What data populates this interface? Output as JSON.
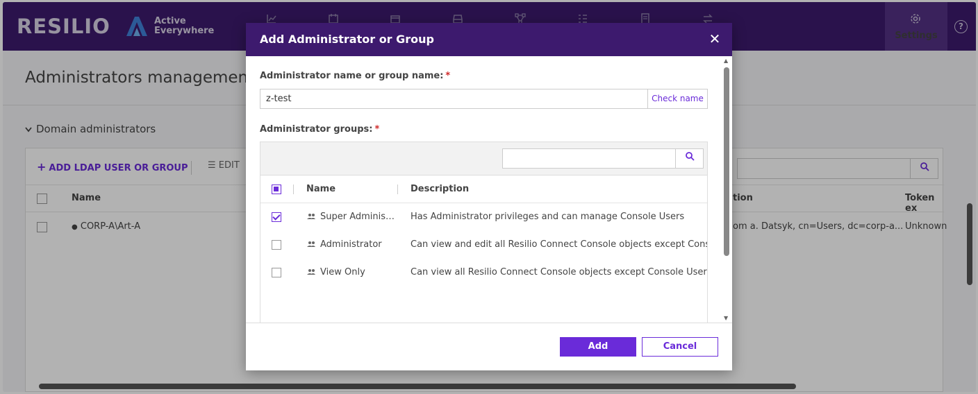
{
  "app": {
    "brand": "RESILIO",
    "product_line1": "Active",
    "product_line2": "Everywhere",
    "nav_settings_label": "Settings",
    "nav_icons": [
      "chart-icon",
      "calendar-icon",
      "package-icon",
      "storage-icon",
      "network-icon",
      "list-icon",
      "report-icon",
      "transfer-icon"
    ]
  },
  "page": {
    "title": "Administrators management",
    "section_title": "Domain administrators",
    "toolbar": {
      "add_label": "ADD LDAP USER OR GROUP",
      "edit_label": "EDIT"
    },
    "columns": {
      "name": "Name",
      "description_partial": "tion",
      "token_partial": "Token ex"
    },
    "rows": [
      {
        "name": "CORP-A\\Art-A",
        "description": "om a. Datsyk, cn=Users, dc=corp-a...",
        "token": "Unknown"
      }
    ]
  },
  "dialog": {
    "title": "Add Administrator or Group",
    "name_label": "Administrator name or group name:",
    "required_mark": "*",
    "name_value": "z-test",
    "check_name_label": "Check name",
    "groups_label": "Administrator groups:",
    "search_placeholder": "",
    "columns": {
      "name": "Name",
      "description": "Description"
    },
    "groups": [
      {
        "name": "Super Administrator",
        "description": "Has Administrator privileges and can manage Console Users",
        "checked": true
      },
      {
        "name": "Administrator",
        "description": "Can view and edit all Resilio Connect Console objects except Console Users",
        "checked": false
      },
      {
        "name": "View Only",
        "description": "Can view all Resilio Connect Console objects except Console Users",
        "checked": false
      }
    ],
    "add_label": "Add",
    "cancel_label": "Cancel"
  },
  "colors": {
    "header_bg": "#3d1a6e",
    "accent": "#6a2bd9",
    "required": "#d02a2a"
  }
}
